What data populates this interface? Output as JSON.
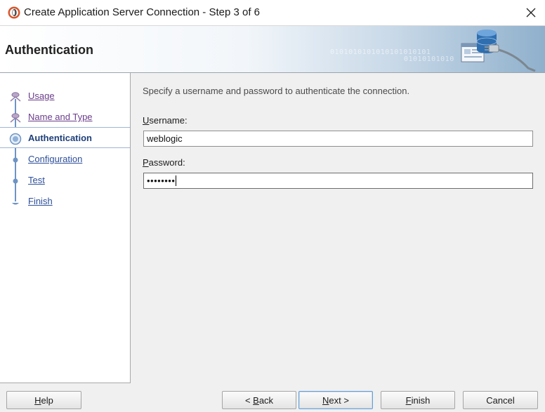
{
  "window": {
    "title": "Create Application Server Connection - Step 3 of 6",
    "close_glyph": "✕"
  },
  "banner": {
    "title": "Authentication",
    "binary_top": "0101010101010101010101",
    "binary_bottom": "01010101010"
  },
  "steps": [
    {
      "label": "Usage",
      "state": "visited"
    },
    {
      "label": "Name and Type",
      "state": "visited"
    },
    {
      "label": "Authentication",
      "state": "current"
    },
    {
      "label": "Configuration",
      "state": "pending"
    },
    {
      "label": "Test",
      "state": "pending"
    },
    {
      "label": "Finish",
      "state": "pending"
    }
  ],
  "form": {
    "instruction": "Specify a username and password to authenticate the connection.",
    "username": {
      "label_mn": "U",
      "label_rest": "sername:",
      "value": "weblogic"
    },
    "password": {
      "label_mn": "P",
      "label_rest": "assword:",
      "masked": "••••••••"
    }
  },
  "buttons": {
    "help": {
      "mn": "H",
      "rest": "elp"
    },
    "back": {
      "pre": "< ",
      "mn": "B",
      "rest": "ack"
    },
    "next": {
      "mn": "N",
      "rest": "ext >"
    },
    "finish": {
      "mn": "F",
      "rest": "inish"
    },
    "cancel": {
      "label": "Cancel"
    }
  },
  "colors": {
    "nav_visited": "#6a3d8a",
    "nav_pending": "#2d4f9a",
    "nav_current": "#1e3f7a",
    "train_line": "#6e94c4",
    "default_button_border": "#6a9ed1"
  },
  "icons": {
    "app": "oracle-jdeveloper-icon",
    "banner": "server-connection-icon",
    "close": "close-icon"
  }
}
